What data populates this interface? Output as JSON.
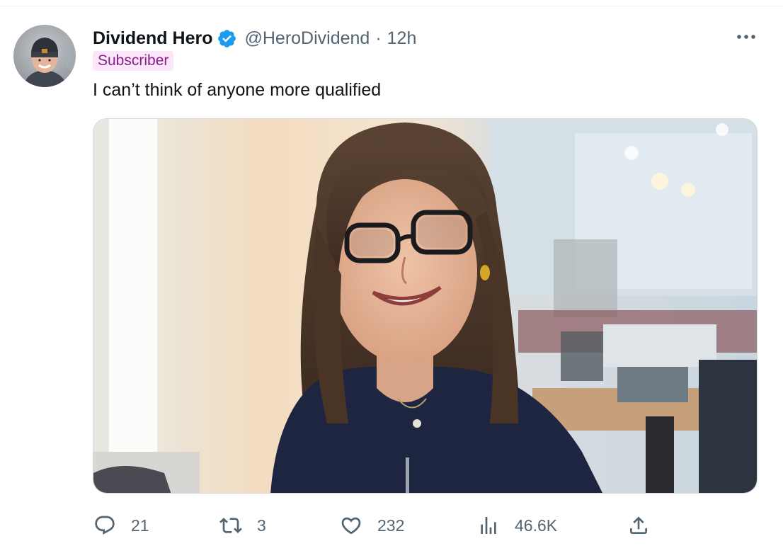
{
  "tweet": {
    "display_name": "Dividend Hero",
    "handle": "@HeroDividend",
    "separator": "·",
    "time": "12h",
    "badge": "Subscriber",
    "text": "I can’t think of anyone more qualified",
    "icons": {
      "verified": "verified-badge-icon",
      "more": "more-options-icon",
      "reply": "reply-icon",
      "retweet": "retweet-icon",
      "like": "like-icon",
      "views": "views-icon",
      "share": "share-icon"
    },
    "stats": {
      "replies": "21",
      "retweets": "3",
      "likes": "232",
      "views": "46.6K"
    }
  },
  "colors": {
    "verified_blue": "#1d9bf0",
    "secondary_text": "#536471",
    "badge_bg": "#fbe6fa",
    "badge_text": "#8a1f8a"
  }
}
